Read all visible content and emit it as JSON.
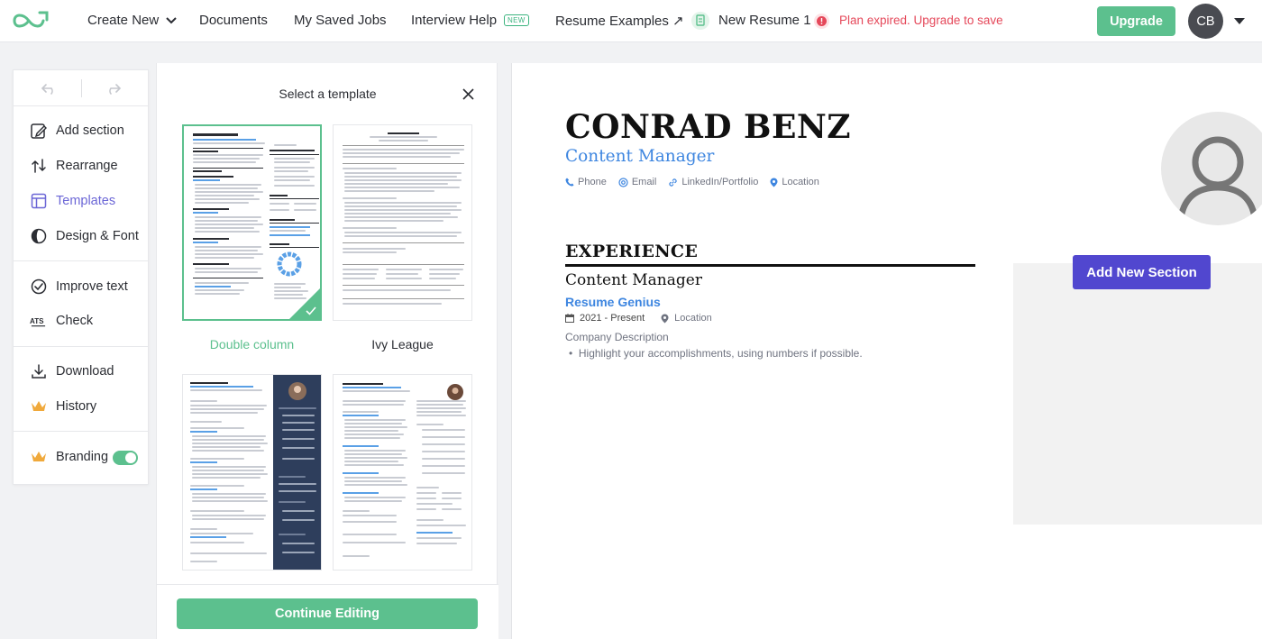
{
  "nav": {
    "create_new": "Create New",
    "documents": "Documents",
    "saved_jobs": "My Saved Jobs",
    "interview_help": "Interview Help",
    "new_badge": "NEW",
    "resume_examples": "Resume Examples ↗",
    "doc_name": "New Resume 1",
    "plan_warning": "Plan expired. Upgrade to save",
    "upgrade": "Upgrade",
    "avatar_initials": "CB"
  },
  "toolbar": {
    "items": [
      {
        "label": "Add section",
        "icon": "add-section-icon"
      },
      {
        "label": "Rearrange",
        "icon": "rearrange-icon"
      },
      {
        "label": "Templates",
        "icon": "templates-icon"
      },
      {
        "label": "Design & Font",
        "icon": "design-font-icon"
      },
      {
        "label": "Improve text",
        "icon": "improve-text-icon"
      },
      {
        "label": "Check",
        "icon": "ats-check-icon"
      },
      {
        "label": "Download",
        "icon": "download-icon"
      },
      {
        "label": "History",
        "icon": "crown-icon"
      },
      {
        "label": "Branding",
        "icon": "crown-icon"
      }
    ],
    "branding_enabled": true
  },
  "templates": {
    "title": "Select a template",
    "cards": [
      {
        "name": "Double column",
        "selected": true
      },
      {
        "name": "Ivy League",
        "selected": false
      },
      {
        "name": "",
        "selected": false
      },
      {
        "name": "",
        "selected": false
      }
    ],
    "continue": "Continue Editing"
  },
  "resume": {
    "name": "CONRAD BENZ",
    "title": "Content Manager",
    "contacts": [
      "Phone",
      "Email",
      "LinkedIn/Portfolio",
      "Location"
    ],
    "section": "EXPERIENCE",
    "job_title": "Content Manager",
    "company": "Resume Genius",
    "dates": "2021 - Present",
    "location": "Location",
    "company_desc": "Company Description",
    "bullet": "Highlight your accomplishments, using numbers if possible.",
    "add_section": "Add New Section"
  },
  "colors": {
    "green": "#5cc08e",
    "purple": "#5147cf",
    "blue": "#3e86e0",
    "red": "#e5485a"
  }
}
